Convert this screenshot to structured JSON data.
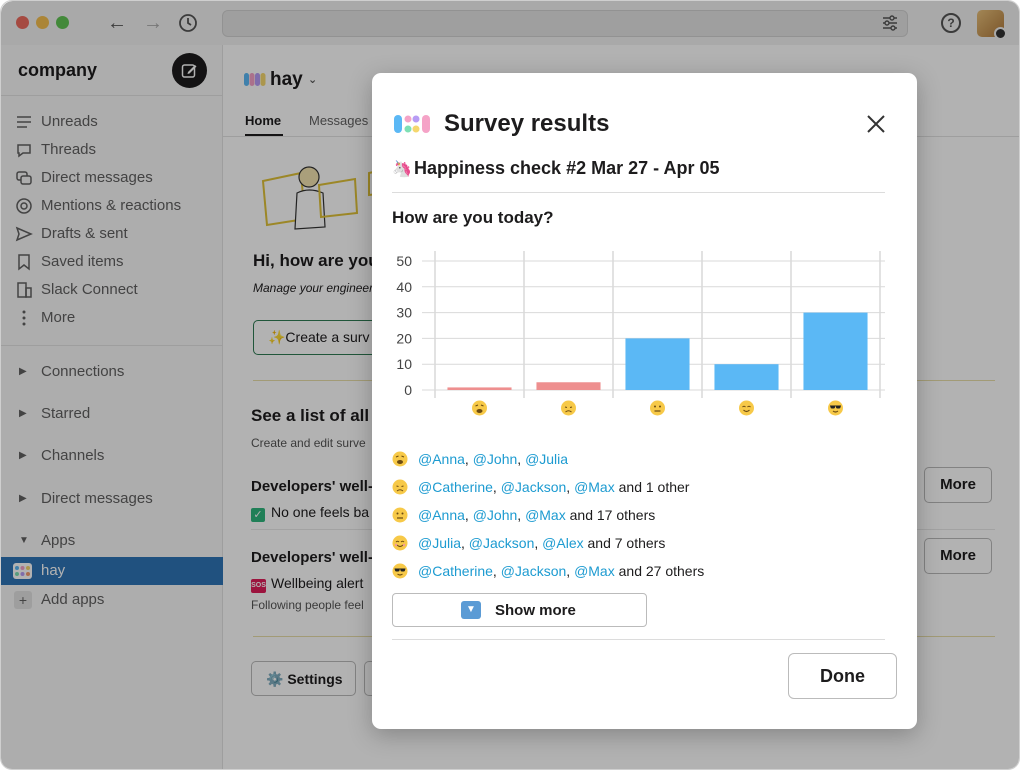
{
  "sidebar": {
    "workspace": "company",
    "items": [
      {
        "label": "Unreads"
      },
      {
        "label": "Threads"
      },
      {
        "label": "Direct messages"
      },
      {
        "label": "Mentions & reactions"
      },
      {
        "label": "Drafts & sent"
      },
      {
        "label": "Saved items"
      },
      {
        "label": "Slack Connect"
      },
      {
        "label": "More"
      }
    ],
    "sections": [
      {
        "label": "Connections"
      },
      {
        "label": "Starred"
      },
      {
        "label": "Channels"
      },
      {
        "label": "Direct messages"
      },
      {
        "label": "Apps"
      }
    ],
    "app_item": "hay",
    "add_apps": "Add apps"
  },
  "main": {
    "app_name": "hay",
    "tabs": [
      "Home",
      "Messages"
    ],
    "greeting": "Hi, how are you",
    "greeting_sub": "Manage your engineer",
    "create_button": "✨Create a surv",
    "list_title": "See a list of all y",
    "list_sub": "Create and edit surve",
    "rows": [
      {
        "title": "Developers' well-",
        "text": "No one feels ba",
        "more": "More"
      },
      {
        "title": "Developers' well-",
        "text": "Wellbeing alert",
        "note": "Following people feel",
        "more": "More"
      }
    ],
    "settings_button": "⚙️ Settings"
  },
  "modal": {
    "title": "Survey results",
    "subtitle": "Happiness check #2 Mar 27 - Apr 05",
    "question": "How are you today?",
    "responses": [
      {
        "emoji": "weary-face",
        "mentions": [
          "@Anna",
          "@John",
          "@Julia"
        ],
        "extra": ""
      },
      {
        "emoji": "disappointed-face",
        "mentions": [
          "@Catherine",
          "@Jackson",
          "@Max"
        ],
        "extra": " and 1 other"
      },
      {
        "emoji": "neutral-face",
        "mentions": [
          "@Anna",
          "@John",
          "@Max"
        ],
        "extra": " and 17 others"
      },
      {
        "emoji": "smiling-face",
        "mentions": [
          "@Julia",
          "@Jackson",
          "@Alex"
        ],
        "extra": " and 7 others"
      },
      {
        "emoji": "sunglasses-face",
        "mentions": [
          "@Catherine",
          "@Jackson",
          "@Max"
        ],
        "extra": " and 27 others"
      }
    ],
    "show_more": "Show more",
    "done": "Done"
  },
  "chart_data": {
    "type": "bar",
    "categories": [
      "weary-face",
      "disappointed-face",
      "neutral-face",
      "smiling-face",
      "sunglasses-face"
    ],
    "values": [
      1,
      3,
      20,
      10,
      30
    ],
    "colors": [
      "#ee8f8f",
      "#ee8f8f",
      "#5bb8f5",
      "#5bb8f5",
      "#5bb8f5"
    ],
    "yticks": [
      0,
      10,
      20,
      30,
      40,
      50
    ],
    "ylim": [
      0,
      50
    ],
    "grid": true
  },
  "colors": {
    "accent": "#2e75b6",
    "mention": "#1d9bd1",
    "bar_negative": "#ee8f8f",
    "bar_positive": "#5bb8f5"
  }
}
